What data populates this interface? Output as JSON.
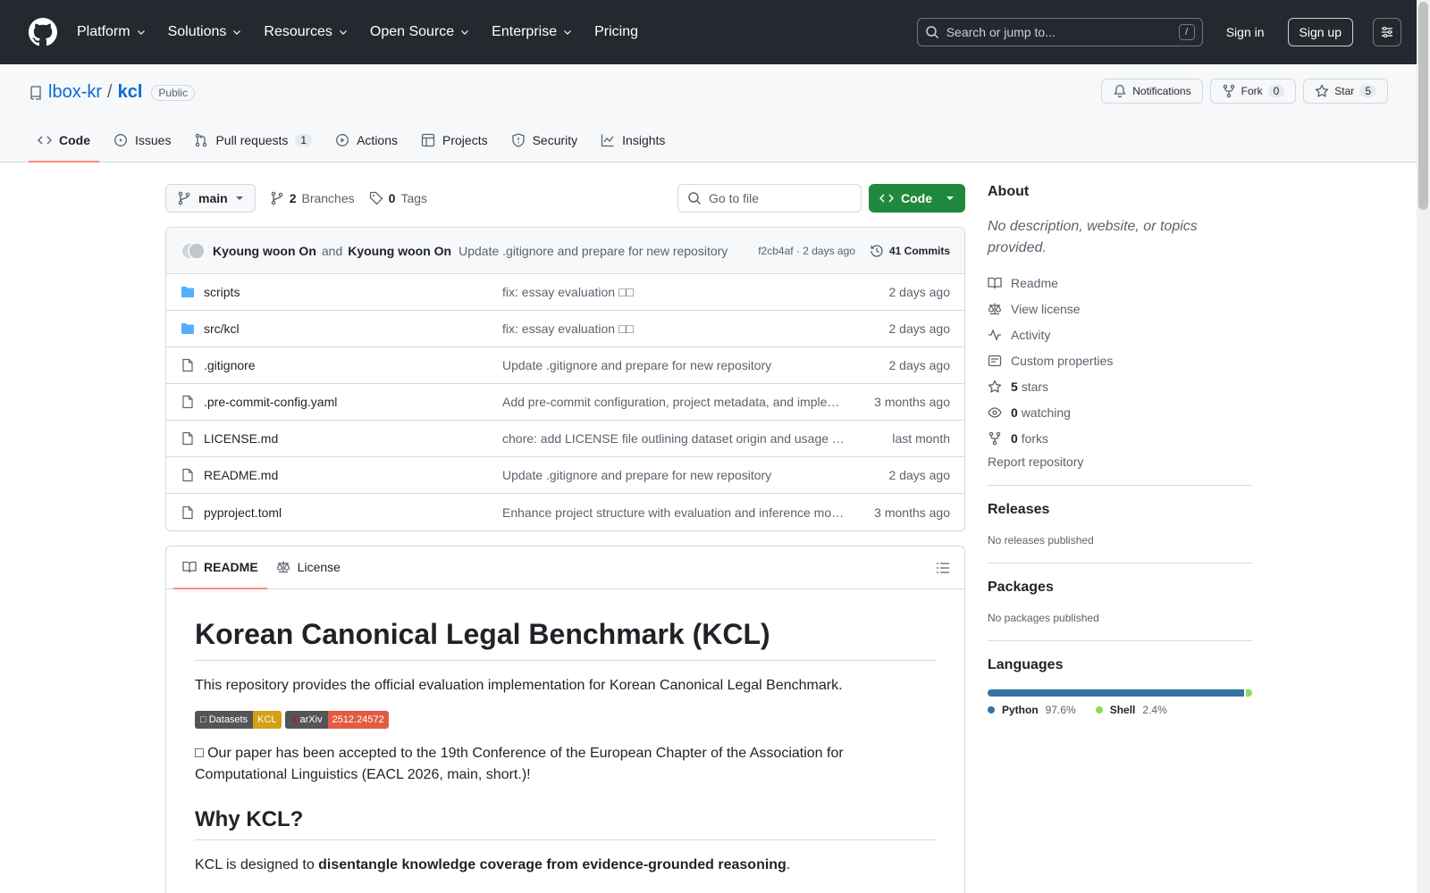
{
  "header": {
    "nav": [
      "Platform",
      "Solutions",
      "Resources",
      "Open Source",
      "Enterprise",
      "Pricing"
    ],
    "search_placeholder": "Search or jump to...",
    "search_shortcut": "/",
    "signin": "Sign in",
    "signup": "Sign up"
  },
  "repo": {
    "owner": "lbox-kr",
    "sep": "/",
    "name": "kcl",
    "visibility": "Public",
    "notifications": "Notifications",
    "fork": "Fork",
    "fork_count": "0",
    "star": "Star",
    "star_count": "5",
    "tabs": {
      "code": "Code",
      "issues": "Issues",
      "pulls": "Pull requests",
      "pulls_count": "1",
      "actions": "Actions",
      "projects": "Projects",
      "security": "Security",
      "insights": "Insights"
    }
  },
  "toolbar": {
    "branch": "main",
    "branches_count": "2",
    "branches_label": "Branches",
    "tags_count": "0",
    "tags_label": "Tags",
    "goto_placeholder": "Go to file",
    "code_button": "Code"
  },
  "commit": {
    "author1": "Kyoung woon On",
    "and": "and",
    "author2": "Kyoung woon On",
    "message": "Update .gitignore and prepare for new repository",
    "meta": "f2cb4af · 2 days ago",
    "count": "41 Commits"
  },
  "files": [
    {
      "name": "scripts",
      "type": "dir",
      "msg": "fix: essay evaluation □□",
      "date": "2 days ago"
    },
    {
      "name": "src/kcl",
      "type": "dir",
      "msg": "fix: essay evaluation □□",
      "date": "2 days ago"
    },
    {
      "name": ".gitignore",
      "type": "file",
      "msg": "Update .gitignore and prepare for new repository",
      "date": "2 days ago"
    },
    {
      "name": ".pre-commit-config.yaml",
      "type": "file",
      "msg": "Add pre-commit configuration, project metadata, and imple…",
      "date": "3 months ago"
    },
    {
      "name": "LICENSE.md",
      "type": "file",
      "msg": "chore: add LICENSE file outlining dataset origin and usage …",
      "date": "last month"
    },
    {
      "name": "README.md",
      "type": "file",
      "msg": "Update .gitignore and prepare for new repository",
      "date": "2 days ago"
    },
    {
      "name": "pyproject.toml",
      "type": "file",
      "msg": "Enhance project structure with evaluation and inference mo…",
      "date": "3 months ago"
    }
  ],
  "readme": {
    "tab_readme": "README",
    "tab_license": "License",
    "title": "Korean Canonical Legal Benchmark (KCL)",
    "intro": "This repository provides the official evaluation implementation for Korean Canonical Legal Benchmark.",
    "badge1_left": "□ Datasets",
    "badge1_right": "KCL",
    "badge2_left": "arXiv",
    "badge2_right": "2512.24572",
    "news": "□ Our paper has been accepted to the 19th Conference of the European Chapter of the Association for Computational Linguistics (EACL 2026, main, short.)!",
    "why_heading": "Why KCL?",
    "why_pre": "KCL is designed to ",
    "why_bold": "disentangle knowledge coverage from evidence-grounded reasoning",
    "why_post": "."
  },
  "about": {
    "heading": "About",
    "description": "No description, website, or topics provided.",
    "readme": "Readme",
    "license": "View license",
    "activity": "Activity",
    "custom": "Custom properties",
    "stars_count": "5",
    "stars_label": "stars",
    "watching_count": "0",
    "watching_label": "watching",
    "forks_count": "0",
    "forks_label": "forks",
    "report": "Report repository"
  },
  "releases": {
    "heading": "Releases",
    "sub": "No releases published"
  },
  "packages": {
    "heading": "Packages",
    "sub": "No packages published"
  },
  "languages": {
    "heading": "Languages",
    "items": [
      {
        "name": "Python",
        "pct": "97.6%",
        "value": 97.6,
        "color": "#3572A5"
      },
      {
        "name": "Shell",
        "pct": "2.4%",
        "value": 2.4,
        "color": "#89e051"
      }
    ]
  },
  "colors": {
    "accent": "#0969da",
    "primary_button": "#1f883d",
    "tab_underline": "#fd8c73",
    "badge_kcl": "#d4a017",
    "badge_arxiv": "#b31b1b"
  }
}
